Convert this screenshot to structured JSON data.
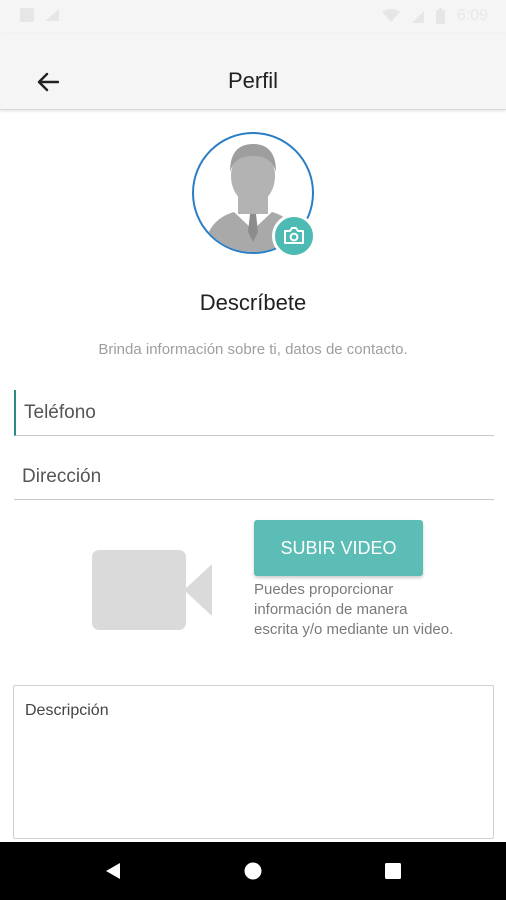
{
  "status_bar": {
    "time": "6:09"
  },
  "app_bar": {
    "title": "Perfil",
    "back_icon": "arrow-left-icon"
  },
  "profile": {
    "avatar_icon": "person-avatar-icon",
    "camera_icon": "camera-icon",
    "heading": "Descríbete",
    "subheading": "Brinda información sobre ti, datos de contacto."
  },
  "form": {
    "phone_placeholder": "Teléfono",
    "address_placeholder": "Dirección",
    "description_placeholder": "Descripción"
  },
  "video": {
    "icon": "video-camera-icon",
    "upload_label": "SUBIR VIDEO",
    "help_text": "Puedes proporcionar información de manera escrita y/o mediante un video."
  },
  "nav": {
    "back_icon": "nav-back-icon",
    "home_icon": "nav-home-icon",
    "recents_icon": "nav-recents-icon"
  },
  "colors": {
    "accent": "#5cbdb6",
    "avatar_ring": "#2a7ec5",
    "cursor": "#2a8a84"
  }
}
